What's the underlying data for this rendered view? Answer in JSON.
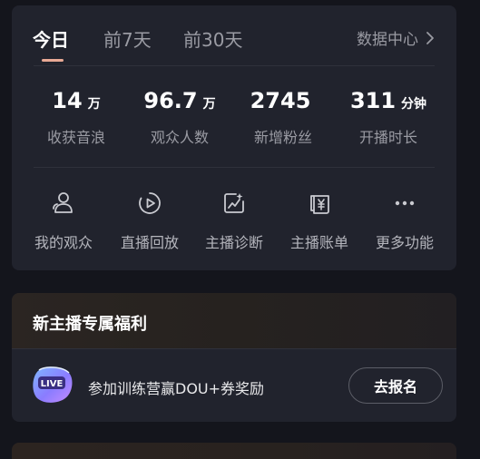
{
  "tabs": [
    {
      "label": "今日",
      "active": true
    },
    {
      "label": "前7天",
      "active": false
    },
    {
      "label": "前30天",
      "active": false
    }
  ],
  "data_center": {
    "label": "数据中心",
    "icon": "chevron-right-icon"
  },
  "stats": [
    {
      "value": "14",
      "unit": "万",
      "label": "收获音浪"
    },
    {
      "value": "96.7",
      "unit": "万",
      "label": "观众人数"
    },
    {
      "value": "2745",
      "unit": "",
      "label": "新增粉丝"
    },
    {
      "value": "311",
      "unit": "分钟",
      "label": "开播时长"
    }
  ],
  "actions": [
    {
      "label": "我的观众",
      "icon": "users-icon"
    },
    {
      "label": "直播回放",
      "icon": "replay-icon"
    },
    {
      "label": "主播诊断",
      "icon": "diagnosis-chart-icon"
    },
    {
      "label": "主播账单",
      "icon": "bill-icon"
    },
    {
      "label": "更多功能",
      "icon": "more-icon"
    }
  ],
  "welfare": {
    "title": "新主播专属福利",
    "badge_text": "LIVE",
    "text": "参加训练营赢DOU+券奖励",
    "button": "去报名"
  },
  "colors": {
    "background": "#14151c",
    "card": "#21232d",
    "accent_underline": "#e8a995",
    "muted_text": "#9a9ba3"
  }
}
